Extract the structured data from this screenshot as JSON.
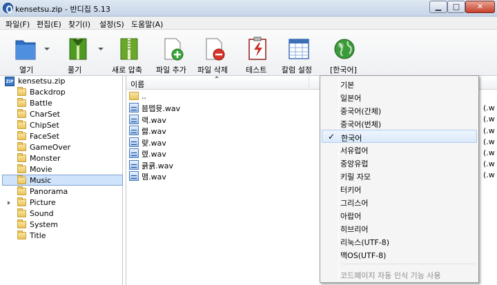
{
  "window": {
    "title": "kensetsu.zip - 반디집 5.13",
    "minimize_glyph": "▁",
    "maximize_glyph": "□",
    "close_glyph": "✕"
  },
  "menu": [
    "파일(F)",
    "편집(E)",
    "찾기(I)",
    "설정(S)",
    "도움말(A)"
  ],
  "toolbar": [
    {
      "label": "열기",
      "icon": "open-icon",
      "color": "#2f6fc7"
    },
    {
      "label": "풀기",
      "icon": "extract-icon",
      "color": "#4e9a23"
    },
    {
      "label": "새로 압축",
      "icon": "compress-icon",
      "color": "#6aa82a"
    },
    {
      "label": "파일 추가",
      "icon": "add-file-icon",
      "color": "#3aa63a"
    },
    {
      "label": "파일 삭제",
      "icon": "delete-file-icon",
      "color": "#d9342b"
    },
    {
      "label": "테스트",
      "icon": "test-icon",
      "color": "#c8322a"
    },
    {
      "label": "칼럼 설정",
      "icon": "column-settings-icon",
      "color": "#3d6fb6"
    },
    {
      "label": "[한국어]",
      "icon": "globe-icon",
      "color": "#3b9a3b"
    }
  ],
  "tree": {
    "root": "kensetsu.zip",
    "root_badge": "ZIP",
    "folders": [
      "Backdrop",
      "Battle",
      "CharSet",
      "ChipSet",
      "FaceSet",
      "GameOver",
      "Monster",
      "Movie",
      "Music",
      "Panorama",
      "Picture",
      "Sound",
      "System",
      "Title"
    ],
    "selected": "Music"
  },
  "list": {
    "header_name": "이름",
    "up": "..",
    "files": [
      "븜뗍뮷.wav",
      "랙.wav",
      "렗.wav",
      "럊.wav",
      "렜.wav",
      "큙큙.wav",
      "맴.wav"
    ],
    "trailing": [
      "(.w",
      "(.w",
      "(.w",
      "(.w",
      "(.w",
      "(.w",
      "(.w",
      "(.w",
      "(.w"
    ]
  },
  "language_menu": {
    "items": [
      "기본",
      "일본어",
      "중국어(간체)",
      "중국어(번체)",
      "한국어",
      "서유럽어",
      "중앙유럽",
      "키릴 자모",
      "터키어",
      "그리스어",
      "아랍어",
      "히브리어",
      "리눅스(UTF-8)",
      "맥OS(UTF-8)"
    ],
    "checked": "한국어",
    "check_glyph": "✓",
    "footer": "코드페이지 자동 인식 기능 사용"
  }
}
